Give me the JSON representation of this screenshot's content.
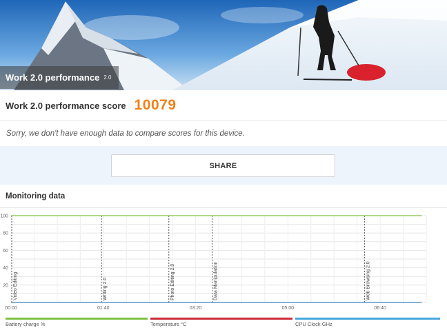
{
  "header": {
    "title": "Work 2.0 performance",
    "version": "2.0"
  },
  "score": {
    "label": "Work 2.0 performance score",
    "value": "10079"
  },
  "message": "Sorry, we don't have enough data to compare scores for this device.",
  "share_label": "SHARE",
  "monitoring": {
    "title": "Monitoring data"
  },
  "chart_data": {
    "type": "line",
    "title": "",
    "xlabel": "",
    "ylabel": "",
    "xlim": [
      "00:00",
      "07:30"
    ],
    "ylim": [
      0,
      100
    ],
    "x_ticks": [
      "00:00",
      "01:40",
      "03:20",
      "05:00",
      "06:40"
    ],
    "y_ticks": [
      20,
      40,
      60,
      80,
      100
    ],
    "grid": true,
    "tasks": [
      {
        "label": "Video Editing",
        "minutes": 0
      },
      {
        "label": "Writing 2.0",
        "minutes": 98
      },
      {
        "label": "Photo Editing 2.0",
        "minutes": 171
      },
      {
        "label": "Data Manipulation",
        "minutes": 218
      },
      {
        "label": "Web Browsing 2.0",
        "minutes": 383
      }
    ],
    "series": [
      {
        "name": "Battery charge %",
        "color": "#7dc142",
        "x_minutes": [
          0,
          445
        ],
        "values": [
          100,
          100
        ]
      },
      {
        "name": "Temperature °C",
        "color": "#cc2a36",
        "x_minutes": [
          0,
          445
        ],
        "values": [
          0,
          0
        ]
      },
      {
        "name": "CPU Clock GHz",
        "color": "#44a6de",
        "x_minutes": [
          0,
          445
        ],
        "values": [
          0,
          0
        ]
      }
    ],
    "legend_position": "bottom"
  }
}
